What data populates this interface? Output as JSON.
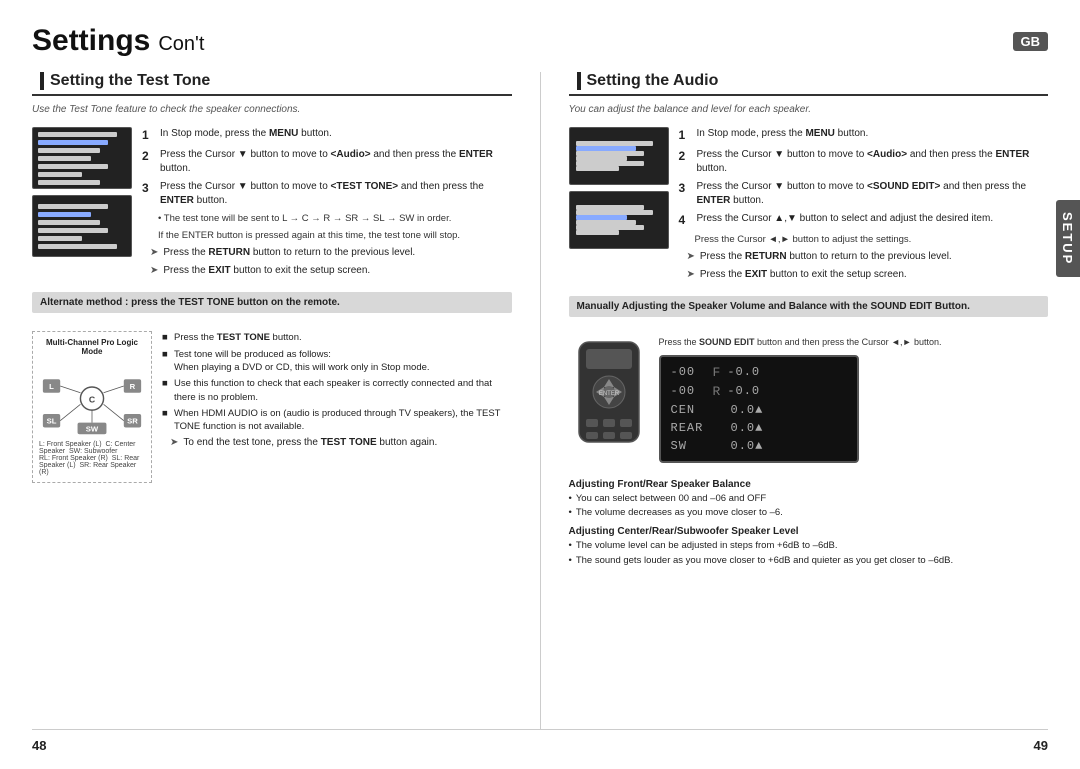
{
  "header": {
    "title_bold": "Settings",
    "title_cont": "Con't",
    "gb": "GB",
    "setup": "SETUP"
  },
  "left_section": {
    "title": "Setting the Test Tone",
    "subtitle": "Use the Test Tone feature to check the speaker connections.",
    "steps": [
      {
        "num": "1",
        "text": "In Stop mode, press the ",
        "bold": "MENU",
        "text2": " button."
      },
      {
        "num": "2",
        "text": "Press the Cursor ▼ button to move to ",
        "bold": "<Audio>",
        "text2": " and then press the ",
        "bold2": "ENTER",
        "text3": " button."
      },
      {
        "num": "3",
        "text": "Press the Cursor ▼ button to move to ",
        "bold": "<TEST TONE>",
        "text2": " and then press the ",
        "bold2": "ENTER",
        "text3": " button."
      }
    ],
    "notes": [
      "The test tone will be sent to L → C → R → SR → SL → SW in order.",
      "If the ENTER button is pressed again at this time, the test tone will stop."
    ],
    "arrows": [
      {
        "text": "Press the ",
        "bold": "RETURN",
        "text2": " button to return to the previous level."
      },
      {
        "text": "Press the ",
        "bold": "EXIT",
        "text2": " button to exit the setup screen."
      }
    ],
    "gray_box": "Alternate method : press the TEST TONE button on the remote.",
    "diagram_title": "Multi-Channel Pro Logic Mode",
    "diagram_labels": [
      "L: Front Speaker (L)  C: Center Speaker  SW: Subwoofer",
      "RL: Front Speaker (R)  SL: Rear Speaker (L)  SR: Rear Speaker (R)"
    ],
    "diagram_bullets": [
      "Press the TEST TONE button.",
      "Test tone will be produced as follows:\nWhen playing a DVD or CD, this will work only in Stop mode.",
      "Use this function to check that each speaker is correctly connected and that there is no problem.",
      "When HDMI AUDIO is on (audio is produced through TV speakers), the TEST TONE function is not available."
    ],
    "end_arrow": {
      "text": "To end the test tone, press the ",
      "bold": "TEST TONE",
      "text2": " button again."
    }
  },
  "right_section": {
    "title": "Setting the Audio",
    "subtitle": "You can adjust the balance and level for each speaker.",
    "steps": [
      {
        "num": "1",
        "text": "In Stop mode, press the ",
        "bold": "MENU",
        "text2": " button."
      },
      {
        "num": "2",
        "text": "Press the Cursor ▼ button to move to ",
        "bold": "<Audio>",
        "text2": " and then press the ",
        "bold2": "ENTER",
        "text3": " button."
      },
      {
        "num": "3",
        "text": "Press the Cursor ▼ button to move to ",
        "bold": "<SOUND EDIT>",
        "text2": " and then press the ",
        "bold2": "ENTER",
        "text3": " button."
      },
      {
        "num": "4",
        "text": "Press the Cursor ▲,▼ button to select and adjust the desired item."
      }
    ],
    "step4_note": "Press the Cursor ◄,► button to adjust the settings.",
    "arrows": [
      {
        "text": "Press the ",
        "bold": "RETURN",
        "text2": " button to return to the previous level."
      },
      {
        "text": "Press the ",
        "bold": "EXIT",
        "text2": " button to exit the setup screen."
      }
    ],
    "gray_box": "Manually Adjusting the Speaker Volume and Balance with the SOUND EDIT Button.",
    "display_instruction": "Press the SOUND EDIT button and then press the Cursor ◄,► button.",
    "display_rows": [
      {
        "label": "-00",
        "mid": "F",
        "value": "-0.0"
      },
      {
        "label": "-00",
        "mid": "R",
        "value": "-0.0"
      },
      {
        "label": "CEN",
        "mid": "",
        "value": "0.0▲"
      },
      {
        "label": "REAR",
        "mid": "",
        "value": "0.0▲"
      },
      {
        "label": "SW",
        "mid": "",
        "value": "0.0▲"
      }
    ],
    "adjusting": [
      {
        "title": "Adjusting Front/Rear Speaker Balance",
        "bullets": [
          "You can select between 00 and –06 and OFF",
          "The volume decreases as you move closer to –6."
        ]
      },
      {
        "title": "Adjusting Center/Rear/Subwoofer Speaker Level",
        "bullets": [
          "The volume level can be adjusted in steps from +6dB to –6dB.",
          "The sound gets louder as you move closer to +6dB and quieter as you get closer to –6dB."
        ]
      }
    ]
  },
  "footer": {
    "page_left": "48",
    "page_right": "49"
  }
}
